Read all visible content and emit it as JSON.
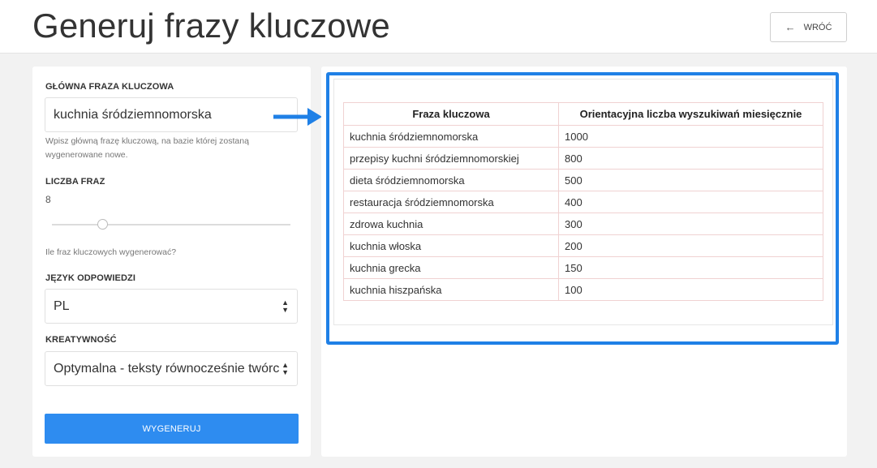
{
  "header": {
    "title": "Generuj frazy kluczowe",
    "back_label": "WRÓĆ",
    "back_icon": "arrow-left-icon"
  },
  "form": {
    "main_phrase": {
      "label": "GŁÓWNA FRAZA KLUCZOWA",
      "value": "kuchnia śródziemnomorska",
      "help": "Wpisz główną frazę kluczową, na bazie której zostaną wygenerowane nowe."
    },
    "phrase_count": {
      "label": "LICZBA FRAZ",
      "value": "8",
      "help": "Ile fraz kluczowych wygenerować?"
    },
    "language": {
      "label": "JĘZYK ODPOWIEDZI",
      "value": "PL"
    },
    "creativity": {
      "label": "KREATYWNOŚĆ",
      "value": "Optymalna - teksty równocześnie twórcze i poprawne"
    },
    "generate_label": "WYGENERUJ"
  },
  "results": {
    "columns": [
      "Fraza kluczowa",
      "Orientacyjna liczba wyszukiwań miesięcznie"
    ],
    "rows": [
      [
        "kuchnia śródziemnomorska",
        "1000"
      ],
      [
        "przepisy kuchni śródziemnomorskiej",
        "800"
      ],
      [
        "dieta śródziemnomorska",
        "500"
      ],
      [
        "restauracja śródziemnomorska",
        "400"
      ],
      [
        "zdrowa kuchnia",
        "300"
      ],
      [
        "kuchnia włoska",
        "200"
      ],
      [
        "kuchnia grecka",
        "150"
      ],
      [
        "kuchnia hiszpańska",
        "100"
      ]
    ]
  },
  "colors": {
    "accent": "#2e8cf0",
    "highlight": "#1f80e6"
  }
}
